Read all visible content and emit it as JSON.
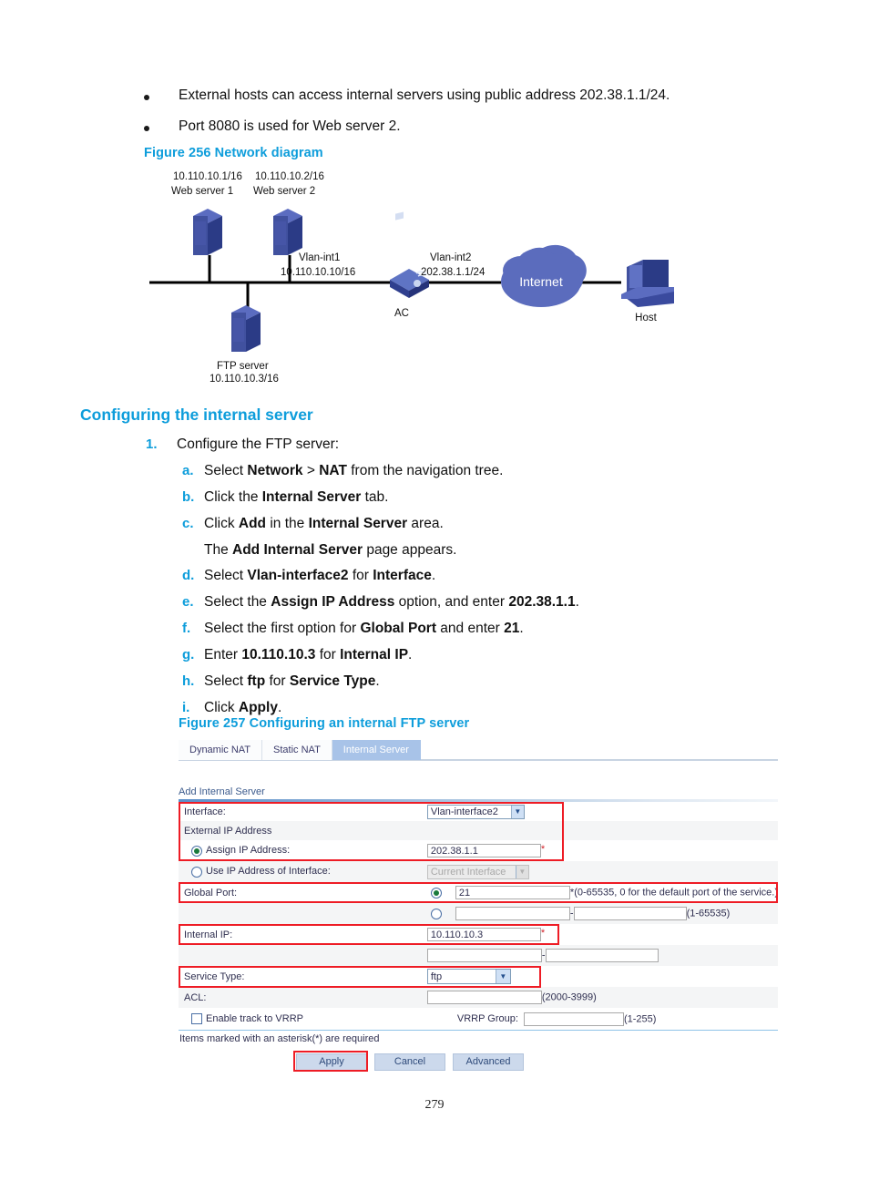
{
  "bullets": [
    "External hosts can access internal servers using public address 202.38.1.1/24.",
    "Port 8080 is used for Web server 2."
  ],
  "figure256": {
    "caption": "Figure 256 Network diagram",
    "nodes": {
      "web1_ip": "10.110.10.1/16",
      "web1_name": "Web server 1",
      "web2_ip": "10.110.10.2/16",
      "web2_name": "Web server 2",
      "ftp_name": "FTP server",
      "ftp_ip": "10.110.10.3/16",
      "vlan1_name": "Vlan-int1",
      "vlan1_ip": "10.110.10.10/16",
      "vlan2_name": "Vlan-int2",
      "vlan2_ip": "202.38.1.1/24",
      "ac_label": "AC",
      "cloud_label": "Internet",
      "host_label": "Host"
    }
  },
  "section": {
    "heading": "Configuring the internal server"
  },
  "steps": [
    {
      "num": "1.",
      "text": "Configure the FTP server:",
      "substeps": [
        {
          "letter": "a.",
          "html": "Select <b>Network</b> &gt; <b>NAT</b> from the navigation tree."
        },
        {
          "letter": "b.",
          "html": "Click the <b>Internal Server</b> tab."
        },
        {
          "letter": "c.",
          "html": "Click <b>Add</b> in the <b>Internal Server</b> area."
        },
        {
          "letter": "",
          "html": "The <b>Add Internal Server</b> page appears.",
          "note": true
        },
        {
          "letter": "d.",
          "html": "Select <b>Vlan-interface2</b> for <b>Interface</b>."
        },
        {
          "letter": "e.",
          "html": "Select the <b>Assign IP Address</b> option, and enter <b>202.38.1.1</b>."
        },
        {
          "letter": "f.",
          "html": "Select the first option for <b>Global Port</b> and enter <b>21</b>."
        },
        {
          "letter": "g.",
          "html": "Enter <b>10.110.10.3</b> for <b>Internal IP</b>."
        },
        {
          "letter": "h.",
          "html": "Select <b>ftp</b> for <b>Service Type</b>."
        },
        {
          "letter": "i.",
          "html": "Click <b>Apply</b>."
        }
      ]
    }
  ],
  "figure257": {
    "caption": "Figure 257 Configuring an internal FTP server",
    "tabs": [
      {
        "label": "Dynamic NAT",
        "active": false
      },
      {
        "label": "Static NAT",
        "active": false
      },
      {
        "label": "Internal Server",
        "active": true
      }
    ],
    "panel_title": "Add Internal Server",
    "fields": {
      "interface_label": "Interface:",
      "interface_value": "Vlan-interface2",
      "external_ip_label": "External IP Address",
      "assign_ip_label": "Assign IP Address:",
      "assign_ip_value": "202.38.1.1",
      "use_ip_label": "Use IP Address of Interface:",
      "use_ip_value": "Current Interface",
      "global_port_label": "Global Port:",
      "global_port_value": "21",
      "global_port_hint": "*(0-65535, 0 for the default port of the service.)",
      "port_range_hint": "(1-65535)",
      "port_range_sep": "-",
      "internal_ip_label": "Internal IP:",
      "internal_ip_value": "10.110.10.3",
      "internal_ip_range_sep": "-",
      "service_type_label": "Service Type:",
      "service_type_value": "ftp",
      "acl_label": "ACL:",
      "acl_value": "",
      "acl_hint": "(2000-3999)",
      "vrrp_track_label": "Enable track to VRRP",
      "vrrp_group_label": "VRRP Group:",
      "vrrp_group_value": "",
      "vrrp_hint": "(1-255)",
      "required_note": "Items marked with an asterisk(*) are required",
      "asterisk": "*"
    },
    "buttons": {
      "apply": "Apply",
      "cancel": "Cancel",
      "advanced": "Advanced"
    }
  },
  "page_number": "279",
  "colors": {
    "accent_blue": "#0d9ddb",
    "annotation_red": "#ee1c25",
    "tab_active_bg": "#a8c3e8",
    "device_blue": "#3a4a9b"
  }
}
